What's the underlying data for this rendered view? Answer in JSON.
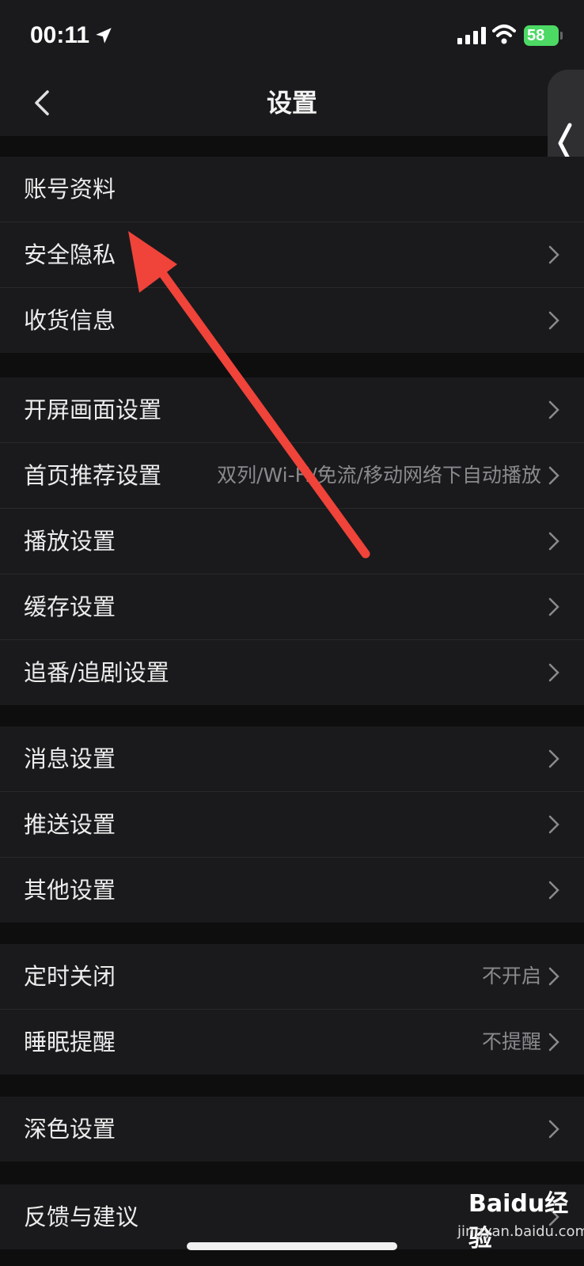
{
  "status": {
    "time": "00:11",
    "battery": "58"
  },
  "nav": {
    "title": "设置"
  },
  "groups": [
    {
      "items": [
        {
          "label": "账号资料",
          "value": ""
        },
        {
          "label": "安全隐私",
          "value": ""
        },
        {
          "label": "收货信息",
          "value": ""
        }
      ]
    },
    {
      "items": [
        {
          "label": "开屏画面设置",
          "value": ""
        },
        {
          "label": "首页推荐设置",
          "value": "双列/Wi-Fi/免流/移动网络下自动播放"
        },
        {
          "label": "播放设置",
          "value": ""
        },
        {
          "label": "缓存设置",
          "value": ""
        },
        {
          "label": "追番/追剧设置",
          "value": ""
        }
      ]
    },
    {
      "items": [
        {
          "label": "消息设置",
          "value": ""
        },
        {
          "label": "推送设置",
          "value": ""
        },
        {
          "label": "其他设置",
          "value": ""
        }
      ]
    },
    {
      "items": [
        {
          "label": "定时关闭",
          "value": "不开启"
        },
        {
          "label": "睡眠提醒",
          "value": "不提醒"
        }
      ]
    },
    {
      "items": [
        {
          "label": "深色设置",
          "value": ""
        }
      ]
    },
    {
      "items": [
        {
          "label": "反馈与建议",
          "value": ""
        }
      ]
    }
  ],
  "watermark": {
    "brand": "Baidu经验",
    "url": "jingyan.baidu.com"
  },
  "colors": {
    "annotation_arrow": "#f0433a",
    "battery": "#4cd964"
  }
}
